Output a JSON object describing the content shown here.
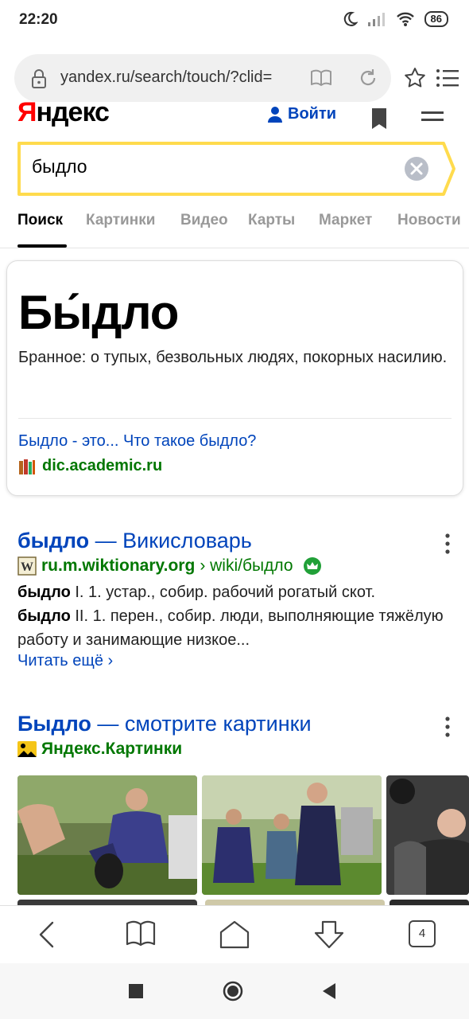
{
  "status": {
    "time": "22:20",
    "battery": "86"
  },
  "browser": {
    "url": "yandex.ru/search/touch/?clid="
  },
  "header": {
    "logo_first": "Я",
    "logo_rest": "ндекс",
    "login": "Войти"
  },
  "search": {
    "query": "быдло"
  },
  "tabs": [
    {
      "label": "Поиск"
    },
    {
      "label": "Картинки"
    },
    {
      "label": "Видео"
    },
    {
      "label": "Карты"
    },
    {
      "label": "Маркет"
    },
    {
      "label": "Новости"
    }
  ],
  "fact": {
    "title": "Бы́дло",
    "text": "Бранное: о тупых, безвольных людях, покорных насилию.",
    "link": "Быдло - это... Что такое быдло?",
    "source": "dic.academic.ru"
  },
  "result1": {
    "title_bold": "быдло",
    "title_rest": " — Викисловарь",
    "host": "ru.m.wiktionary.org",
    "path": " › wiki/быдло",
    "line1_bold": "быдло",
    "line1": " I. 1. устар., собир. рабочий рогатый скот.",
    "line2_bold": "быдло",
    "line2": " II. 1. перен., собир. люди, выполняющие тяжёлую работу и занимающие низкое...",
    "read_more": "Читать ещё ›"
  },
  "result2": {
    "title_bold": "Быдло",
    "title_rest": " — смотрите картинки",
    "source": "Яндекс.Картинки"
  },
  "bottom_nav": {
    "tab_count": "4"
  },
  "colors": {
    "link": "#0044bb",
    "source_green": "#007700",
    "yandex_yellow": "#ffdb4d",
    "yandex_red": "#ff0000"
  }
}
